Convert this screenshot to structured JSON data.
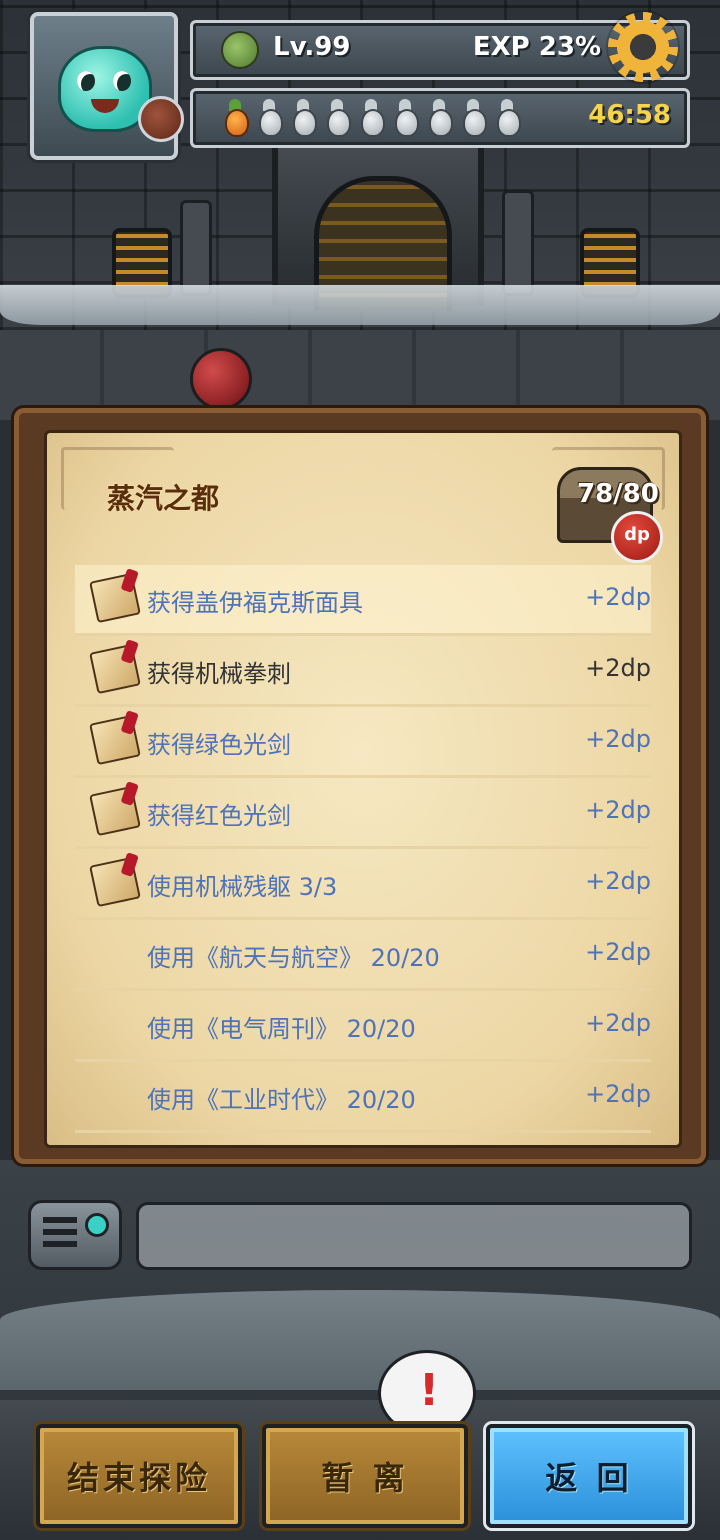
{
  "hud": {
    "level": "Lv.99",
    "exp": "EXP 23%",
    "energy_full": 1,
    "energy_total": 9,
    "timer": "46:58"
  },
  "panel": {
    "title": "蒸汽之都",
    "progress": "78/80",
    "badge": "dp",
    "tasks": [
      {
        "label": "获得盖伊福克斯面具",
        "reward": "+2dp",
        "icon": "scroll-icon",
        "done": false
      },
      {
        "label": "获得机械拳刺",
        "reward": "+2dp",
        "icon": "scroll-icon",
        "done": true
      },
      {
        "label": "获得绿色光剑",
        "reward": "+2dp",
        "icon": "scroll-icon",
        "done": false
      },
      {
        "label": "获得红色光剑",
        "reward": "+2dp",
        "icon": "scroll-icon",
        "done": false
      },
      {
        "label": "使用机械残躯 3/3",
        "reward": "+2dp",
        "icon": "scroll-icon",
        "done": false
      },
      {
        "label": "使用《航天与航空》 20/20",
        "reward": "+2dp",
        "icon": "",
        "done": false
      },
      {
        "label": "使用《电气周刊》 20/20",
        "reward": "+2dp",
        "icon": "",
        "done": false
      },
      {
        "label": "使用《工业时代》 20/20",
        "reward": "+2dp",
        "icon": "",
        "done": false
      }
    ]
  },
  "bottom": {
    "end_label": "结束探险",
    "away_label": "暂 离",
    "back_label": "返 回",
    "alert": "!"
  },
  "colors": {
    "task_text": "#4e73b8",
    "done_text": "#333333",
    "back_button": "#2b8fd9",
    "gold_button": "#b8893a"
  }
}
